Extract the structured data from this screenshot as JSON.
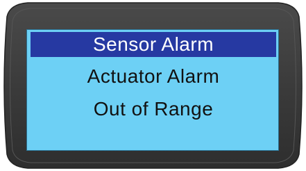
{
  "menu": {
    "items": [
      {
        "label": "Sensor Alarm",
        "selected": true
      },
      {
        "label": "Actuator Alarm",
        "selected": false
      },
      {
        "label": "Out of Range",
        "selected": false
      }
    ]
  },
  "colors": {
    "bezel": "#3a3a3a",
    "screen": "#6dd0f5",
    "selection": "#2639a2",
    "text": "#111111",
    "selected_text": "#ffffff"
  }
}
